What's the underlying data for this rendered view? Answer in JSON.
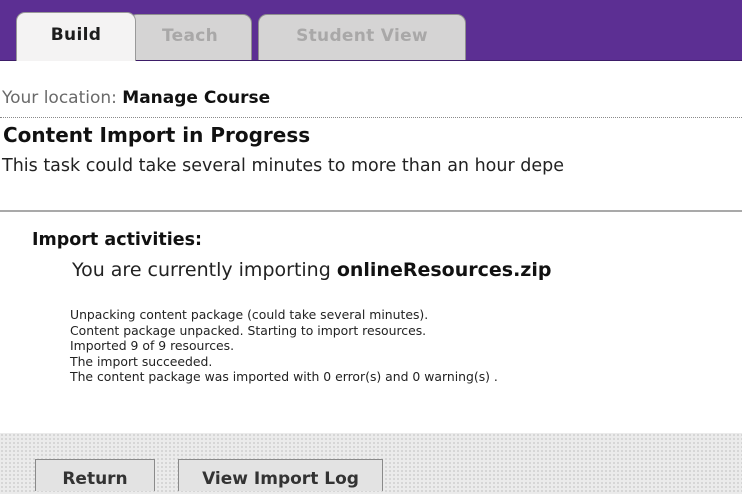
{
  "tabs": [
    {
      "label": "Build",
      "active": true
    },
    {
      "label": "Teach",
      "active": false
    },
    {
      "label": "Student View",
      "active": false
    }
  ],
  "breadcrumb": {
    "prefix": "Your location:",
    "current": "Manage Course"
  },
  "page": {
    "title": "Content Import in Progress",
    "description": "This task could take several minutes to more than an hour depe"
  },
  "import": {
    "section_title": "Import activities:",
    "status_prefix": "You are currently importing",
    "filename": "onlineResources.zip",
    "log": [
      "Unpacking content package (could take several minutes).",
      "Content package unpacked. Starting to import resources.",
      "Imported 9 of 9 resources.",
      "The import succeeded.",
      "The content package was imported with 0 error(s) and 0 warning(s) ."
    ]
  },
  "buttons": {
    "return_label": "Return",
    "view_log_label": "View Import Log"
  },
  "colors": {
    "header_bg": "#5c2f93",
    "active_tab_bg": "#f4f3f3",
    "inactive_tab_bg": "#d5d4d4"
  }
}
